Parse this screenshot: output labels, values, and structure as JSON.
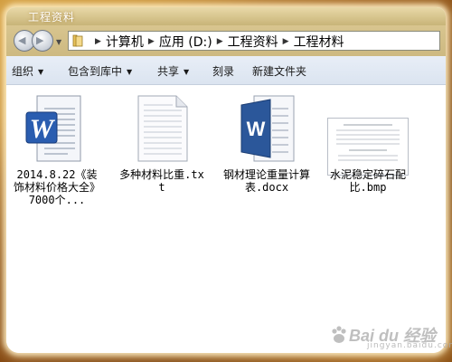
{
  "window": {
    "title": "工程资料"
  },
  "address": {
    "crumbs": [
      "计算机",
      "应用 (D:)",
      "工程资料",
      "工程材料"
    ]
  },
  "toolbar": {
    "organize_label": "组织",
    "include_library_label": "包含到库中",
    "share_label": "共享",
    "burn_label": "刻录",
    "new_folder_label": "新建文件夹"
  },
  "files": [
    {
      "label": "2014.8.22《装饰材料价格大全》7000个...",
      "icon": "word-doc-icon"
    },
    {
      "label": "多种材料比重.txt",
      "icon": "text-file-icon"
    },
    {
      "label": "钢材理论重量计算表.docx",
      "icon": "word-docx-icon"
    },
    {
      "label": "水泥稳定碎石配比.bmp",
      "icon": "bitmap-image-icon"
    }
  ],
  "watermark": {
    "brand": "Bai du 经验",
    "sub": "jingyan.baidu.com"
  }
}
